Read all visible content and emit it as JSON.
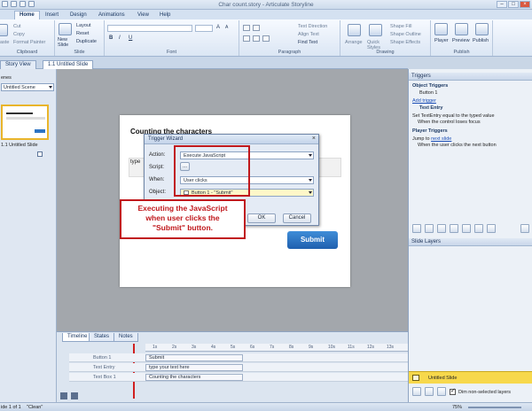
{
  "window": {
    "title": "Char count.story - Articulate Storyline"
  },
  "ribbon": {
    "tabs": [
      "Home",
      "Insert",
      "Design",
      "Animations",
      "View",
      "Help"
    ],
    "clipboard": {
      "cut": "Cut",
      "copy": "Copy",
      "format_painter": "Format Painter",
      "paste": "aste",
      "label": "Clipboard"
    },
    "slide": {
      "new_slide": "New Slide",
      "layout": "Layout",
      "reset": "Reset",
      "duplicate": "Duplicate",
      "label": "Slide"
    },
    "font": {
      "label": "Font",
      "bold": "B",
      "italic": "I",
      "underline": "U",
      "grow": "A",
      "shrink": "A"
    },
    "paragraph": {
      "label": "Paragraph",
      "text_direction": "Text Direction",
      "align_text": "Align Text",
      "find_text": "Find Text"
    },
    "drawing": {
      "label": "Drawing",
      "arrange": "Arrange",
      "quick_styles": "Quick Styles",
      "shape_fill": "Shape Fill",
      "shape_outline": "Shape Outline",
      "shape_effects": "Shape Effects"
    },
    "publish": {
      "label": "Publish",
      "player": "Player",
      "preview": "Preview",
      "publish": "Publish"
    }
  },
  "view_tabs": {
    "story_view": "Story View",
    "slide_tab": "1.1 Untitled Slide"
  },
  "left_panel": {
    "header": "enes",
    "scene": "Untitled Scene",
    "slide_label": "1.1 Untitled Slide"
  },
  "slide": {
    "title": "Counting the characters",
    "type_label": "type",
    "submit": "Submit"
  },
  "dialog": {
    "title": "Trigger Wizard",
    "action_label": "Action:",
    "action_value": "Execute JavaScript",
    "script_label": "Script:",
    "script_button": "...",
    "when_label": "When:",
    "when_value": "User clicks",
    "object_label": "Object:",
    "object_value": "Button 1 - \"Submit\"",
    "ok": "OK",
    "cancel": "Cancel"
  },
  "callout": {
    "line1": "Executing the JavaScript",
    "line2": "when user clicks the",
    "line3": "\"Submit\" button."
  },
  "timeline": {
    "tabs": [
      "Timeline",
      "States",
      "Notes"
    ],
    "ruler": [
      "1s",
      "2s",
      "3s",
      "4s",
      "5s",
      "6s",
      "7s",
      "8s",
      "9s",
      "10s",
      "11s",
      "12s",
      "13s"
    ],
    "rows": [
      {
        "name": "Button 1",
        "bar": "Submit"
      },
      {
        "name": "Text Entry",
        "bar": "type your text here"
      },
      {
        "name": "Text Box 1",
        "bar": "Counting the characters"
      }
    ]
  },
  "triggers": {
    "header": "Triggers",
    "object_triggers": "Object Triggers",
    "button1": "Button 1",
    "add_trigger": "Add trigger",
    "text_entry": "Text Entry",
    "set_line": "Set TextEntry equal to the typed value",
    "when_focus": "When the control loses focus",
    "player_triggers": "Player Triggers",
    "jump_to": "Jump to",
    "next_slide": "next slide",
    "when_next": "When the user clicks the next button"
  },
  "slide_layers": {
    "header": "Slide Layers",
    "untitled_slide": "Untitled Slide",
    "dim_label": "Dim non-selected layers",
    "zoom": "75%"
  },
  "status": {
    "slide": "ide 1 of 1",
    "clean": "\"Clean\""
  }
}
